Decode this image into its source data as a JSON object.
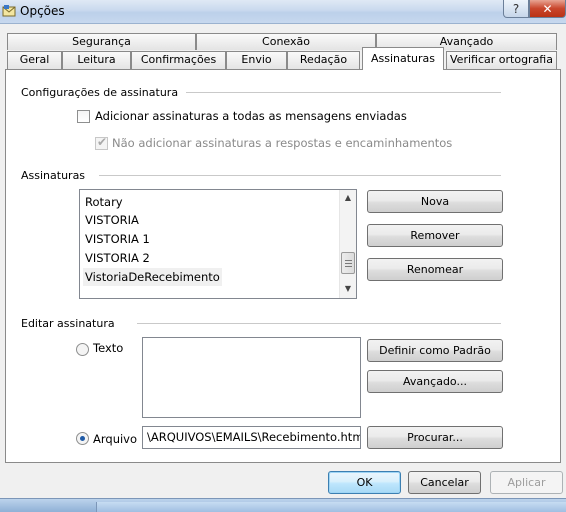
{
  "window": {
    "title": "Opções",
    "help_label": "?",
    "close_label": "✕",
    "icon": "outlook-express-icon"
  },
  "tabs": {
    "row1": [
      "Segurança",
      "Conexão",
      "Avançado"
    ],
    "row2": [
      "Geral",
      "Leitura",
      "Confirmações",
      "Envio",
      "Redação",
      "Assinaturas",
      "Verificar ortografia"
    ],
    "active": "Assinaturas"
  },
  "settings": {
    "group_label": "Configurações de assinatura",
    "add_signatures": {
      "label": "Adicionar assinaturas a todas as mensagens enviadas",
      "checked": false
    },
    "no_replies": {
      "label": "Não adicionar assinaturas a respostas e encaminhamentos",
      "checked": true,
      "disabled": true
    }
  },
  "signatures": {
    "group_label": "Assinaturas",
    "items": [
      "Rotary",
      "VISTORIA",
      "VISTORIA 1",
      "VISTORIA 2",
      "VistoriaDeRecebimento"
    ],
    "selected": "VistoriaDeRecebimento",
    "buttons": {
      "new": "Nova",
      "remove": "Remover",
      "rename": "Renomear"
    }
  },
  "edit": {
    "group_label": "Editar assinatura",
    "text_option": "Texto",
    "file_option": "Arquivo",
    "selected_option": "Arquivo",
    "file_path": "\\ARQUIVOS\\EMAILS\\Recebimento.htm",
    "buttons": {
      "set_default": "Definir como Padrão",
      "advanced": "Avançado...",
      "browse": "Procurar..."
    }
  },
  "dialog_buttons": {
    "ok": "OK",
    "cancel": "Cancelar",
    "apply": "Aplicar"
  }
}
